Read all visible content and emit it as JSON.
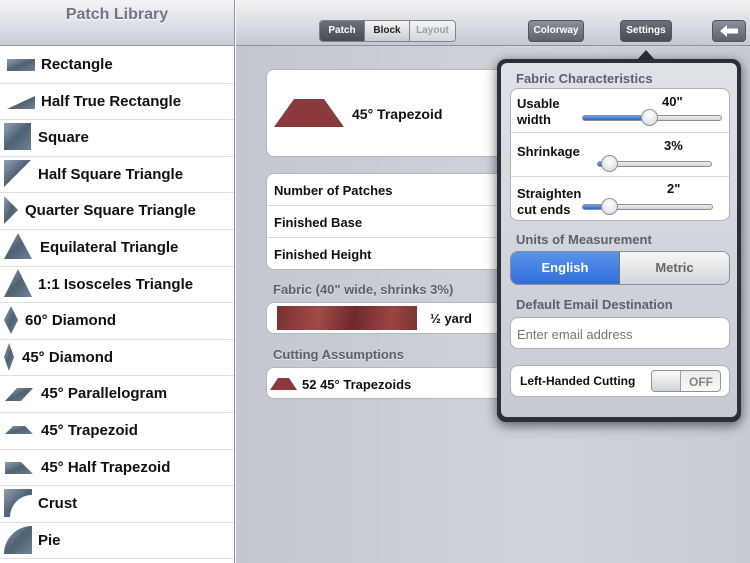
{
  "sidebar": {
    "title": "Patch Library",
    "items": [
      {
        "label": "Rectangle",
        "icon": "rectangle-icon"
      },
      {
        "label": "Half True Rectangle",
        "icon": "half-true-rectangle-icon"
      },
      {
        "label": "Square",
        "icon": "square-icon"
      },
      {
        "label": "Half Square Triangle",
        "icon": "half-square-triangle-icon"
      },
      {
        "label": "Quarter Square Triangle",
        "icon": "quarter-square-triangle-icon"
      },
      {
        "label": "Equilateral Triangle",
        "icon": "equilateral-triangle-icon"
      },
      {
        "label": "1:1 Isosceles Triangle",
        "icon": "isosceles-triangle-icon"
      },
      {
        "label": "60° Diamond",
        "icon": "diamond-60-icon"
      },
      {
        "label": "45° Diamond",
        "icon": "diamond-45-icon"
      },
      {
        "label": "45° Parallelogram",
        "icon": "parallelogram-icon"
      },
      {
        "label": "45° Trapezoid",
        "icon": "trapezoid-icon"
      },
      {
        "label": "45° Half Trapezoid",
        "icon": "half-trapezoid-icon"
      },
      {
        "label": "Crust",
        "icon": "crust-icon"
      },
      {
        "label": "Pie",
        "icon": "pie-icon"
      }
    ]
  },
  "toolbar": {
    "segments": [
      "Patch",
      "Block",
      "Layout"
    ],
    "selected_segment": "Patch",
    "colorway_label": "Colorway",
    "settings_label": "Settings"
  },
  "patch": {
    "name": "45° Trapezoid",
    "rows": [
      "Number of Patches",
      "Finished Base",
      "Finished Height"
    ]
  },
  "fabric": {
    "section_title": "Fabric (40\" wide, shrinks 3%)",
    "amount": "½ yard"
  },
  "cutting": {
    "section_title": "Cutting Assumptions",
    "summary": "52 45° Trapezoids"
  },
  "settings": {
    "fabric_title": "Fabric Characteristics",
    "usable_width_label": "Usable width",
    "usable_width_value": "40\"",
    "usable_width_fraction": 0.48,
    "shrinkage_label": "Shrinkage",
    "shrinkage_value": "3%",
    "shrinkage_fraction": 0.1,
    "straighten_label": "Straighten cut ends",
    "straighten_value": "2\"",
    "straighten_fraction": 0.2,
    "units_title": "Units of Measurement",
    "units": [
      "English",
      "Metric"
    ],
    "selected_unit": "English",
    "email_title": "Default Email Destination",
    "email_placeholder": "Enter email address",
    "email_value": "",
    "left_handed_label": "Left-Handed Cutting",
    "left_handed_state": "OFF"
  },
  "colors": {
    "accent_blue": "#2f6fd8",
    "fabric_red": "#8a3a3a",
    "shape_steel": "#5d7082",
    "toolbar_dark": "#5c626a"
  }
}
